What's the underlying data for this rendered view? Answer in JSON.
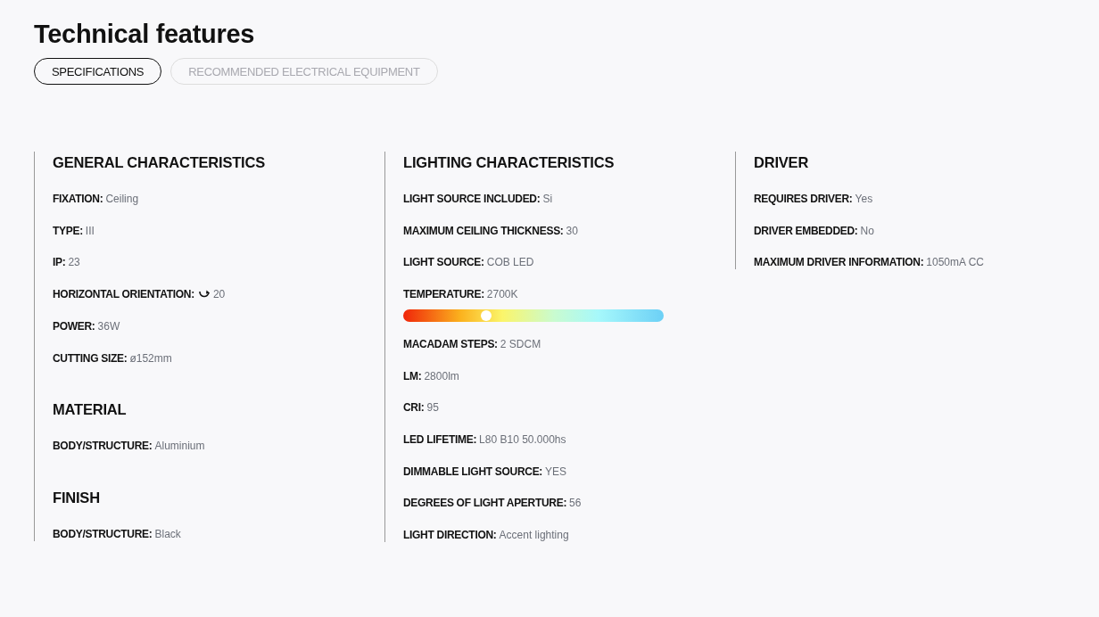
{
  "title": "Technical features",
  "tabs": [
    {
      "label": "SPECIFICATIONS",
      "selected": true
    },
    {
      "label": "RECOMMENDED ELECTRICAL EQUIPMENT",
      "selected": false
    }
  ],
  "columns": [
    {
      "sections": [
        {
          "heading": "GENERAL CHARACTERISTICS",
          "items": [
            {
              "kind": "text",
              "label": "FIXATION:",
              "value": "Ceiling"
            },
            {
              "kind": "text",
              "label": "TYPE:",
              "value": "III"
            },
            {
              "kind": "text",
              "label": "IP:",
              "value": "23"
            },
            {
              "kind": "rotation",
              "label": "HORIZONTAL ORIENTATION:",
              "value": "20"
            },
            {
              "kind": "text",
              "label": "POWER:",
              "value": "36W"
            },
            {
              "kind": "text",
              "label": "CUTTING SIZE:",
              "value": "ø152mm"
            }
          ]
        },
        {
          "heading": "MATERIAL",
          "items": [
            {
              "kind": "text",
              "label": "BODY/STRUCTURE:",
              "value": "Aluminium"
            }
          ]
        },
        {
          "heading": "FINISH",
          "items": [
            {
              "kind": "text",
              "label": "BODY/STRUCTURE:",
              "value": "Black"
            }
          ]
        }
      ]
    },
    {
      "sections": [
        {
          "heading": "LIGHTING CHARACTERISTICS",
          "items": [
            {
              "kind": "text",
              "label": "LIGHT SOURCE INCLUDED:",
              "value": "Si"
            },
            {
              "kind": "text",
              "label": "MAXIMUM CEILING THICKNESS:",
              "value": "30"
            },
            {
              "kind": "text",
              "label": "LIGHT SOURCE:",
              "value": "COB LED"
            },
            {
              "kind": "temperature",
              "label": "TEMPERATURE:",
              "value": "2700K",
              "level": 0.32
            },
            {
              "kind": "text",
              "label": "MACADAM STEPS:",
              "value": "2 SDCM"
            },
            {
              "kind": "text",
              "label": "LM:",
              "value": "2800lm"
            },
            {
              "kind": "text",
              "label": "CRI:",
              "value": "95"
            },
            {
              "kind": "text",
              "label": "LED LIFETIME:",
              "value": "L80 B10 50.000hs"
            },
            {
              "kind": "text",
              "label": "DIMMABLE LIGHT SOURCE:",
              "value": "YES"
            },
            {
              "kind": "text",
              "label": "DEGREES OF LIGHT APERTURE:",
              "value": "56"
            },
            {
              "kind": "text",
              "label": "LIGHT DIRECTION:",
              "value": "Accent lighting"
            }
          ]
        }
      ]
    },
    {
      "sections": [
        {
          "heading": "DRIVER",
          "items": [
            {
              "kind": "text",
              "label": "REQUIRES DRIVER:",
              "value": "Yes"
            },
            {
              "kind": "text",
              "label": "DRIVER EMBEDDED:",
              "value": "No"
            },
            {
              "kind": "text",
              "label": "MAXIMUM DRIVER INFORMATION:",
              "value": "1050mA CC"
            }
          ]
        }
      ]
    }
  ]
}
